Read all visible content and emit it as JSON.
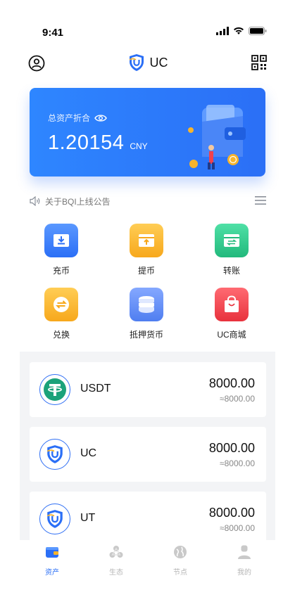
{
  "status_bar": {
    "time": "9:41"
  },
  "nav": {
    "title": "UC"
  },
  "asset_card": {
    "label": "总资产折合",
    "value": "1.20154",
    "unit": "CNY"
  },
  "notice": {
    "text": "关于BQI上线公告"
  },
  "actions": [
    {
      "label": "充币",
      "icon": "deposit-icon",
      "color": "#3d7ff7"
    },
    {
      "label": "提币",
      "icon": "withdraw-icon",
      "color": "#f7b42c"
    },
    {
      "label": "转账",
      "icon": "transfer-icon",
      "color": "#2ec98a"
    },
    {
      "label": "兑换",
      "icon": "exchange-icon",
      "color": "#f7b42c"
    },
    {
      "label": "抵押货币",
      "icon": "coins-stack-icon",
      "color": "#5f8ff7"
    },
    {
      "label": "UC商城",
      "icon": "shopping-bag-icon",
      "color": "#f0414d"
    }
  ],
  "coins": [
    {
      "name": "USDT",
      "amount": "8000.00",
      "approx": "≈8000.00",
      "icon": "tether-icon"
    },
    {
      "name": "UC",
      "amount": "8000.00",
      "approx": "≈8000.00",
      "icon": "uc-shield-icon"
    },
    {
      "name": "UT",
      "amount": "8000.00",
      "approx": "≈8000.00",
      "icon": "uc-shield-icon"
    }
  ],
  "tabs": [
    {
      "label": "资产",
      "icon": "wallet-tab-icon",
      "active": true
    },
    {
      "label": "生态",
      "icon": "ecology-tab-icon",
      "active": false
    },
    {
      "label": "节点",
      "icon": "globe-tab-icon",
      "active": false
    },
    {
      "label": "我的",
      "icon": "profile-tab-icon",
      "active": false
    }
  ],
  "colors": {
    "primary": "#2b6ff6",
    "tether_green": "#1ba27a"
  }
}
